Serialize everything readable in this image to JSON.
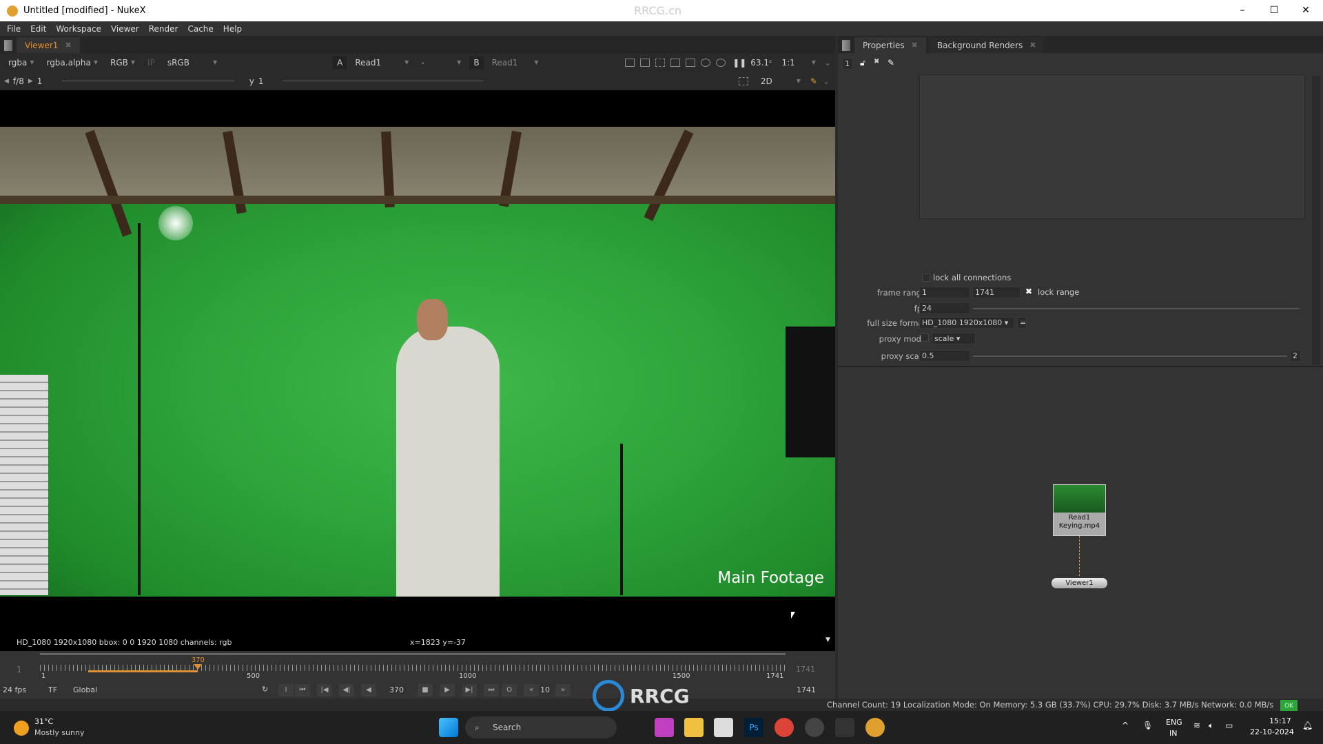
{
  "window": {
    "title": "Untitled [modified] - NukeX",
    "watermark": "RRCG.cn",
    "min": "–",
    "max": "☐",
    "close": "✕"
  },
  "menu": [
    "File",
    "Edit",
    "Workspace",
    "Viewer",
    "Render",
    "Cache",
    "Help"
  ],
  "viewer": {
    "tab": "Viewer1",
    "channels": "rgba",
    "alpha": "rgba.alpha",
    "display": "RGB",
    "ip": "IP",
    "lut": "sRGB",
    "input_a_label": "A",
    "input_a": "Read1",
    "blend": "-",
    "input_b_label": "B",
    "input_b": "Read1",
    "zoom": "63.1ᶜ",
    "ratio": "1:1",
    "fstop": "f/8",
    "gain": "1",
    "gamma_label": "y",
    "gamma": "1",
    "mode": "2D",
    "overlay_text": "Main Footage",
    "info": "HD_1080 1920x1080  bbox: 0 0 1920 1080 channels: rgb",
    "coords": "x=1823 y=-37"
  },
  "timeline": {
    "start": "1",
    "end": "1741",
    "current": "370",
    "current_fraction": 0.212,
    "ticks": [
      "1",
      "500",
      "1000",
      "1500",
      "1741"
    ],
    "fps": "24 fps",
    "tf": "TF",
    "scope": "Global",
    "frame": "370",
    "step": "10",
    "in_label": "I",
    "out_label": "O"
  },
  "properties": {
    "tabs": [
      "Properties",
      "Background Renders"
    ],
    "count": "1",
    "lock_all_connections": "lock all connections",
    "frame_range_label": "frame range",
    "frame_first": "1",
    "frame_last": "1741",
    "lock_range": "lock range",
    "fps_label": "fps",
    "fps": "24",
    "format_label": "full size format",
    "format": "HD_1080 1920x1080",
    "proxy_mode_label": "proxy mode",
    "proxy_mode": "scale",
    "proxy_scale_label": "proxy scale",
    "proxy_scale": "0.5",
    "proxy_btn": "2"
  },
  "nodes": {
    "read": "Read1",
    "read_file": "Keying.mp4",
    "viewer": "Viewer1"
  },
  "status": {
    "text": "Channel Count: 19 Localization Mode: On Memory: 5.3 GB (33.7%) CPU: 29.7% Disk: 3.7 MB/s Network: 0.0 MB/s",
    "ok": "OK"
  },
  "taskbar": {
    "temp": "31°C",
    "weather": "Mostly sunny",
    "search": "Search",
    "lang": "ENG",
    "region": "IN",
    "time": "15:17",
    "date": "22-10-2024"
  },
  "watermark_logo": "RRCG 人人素材"
}
